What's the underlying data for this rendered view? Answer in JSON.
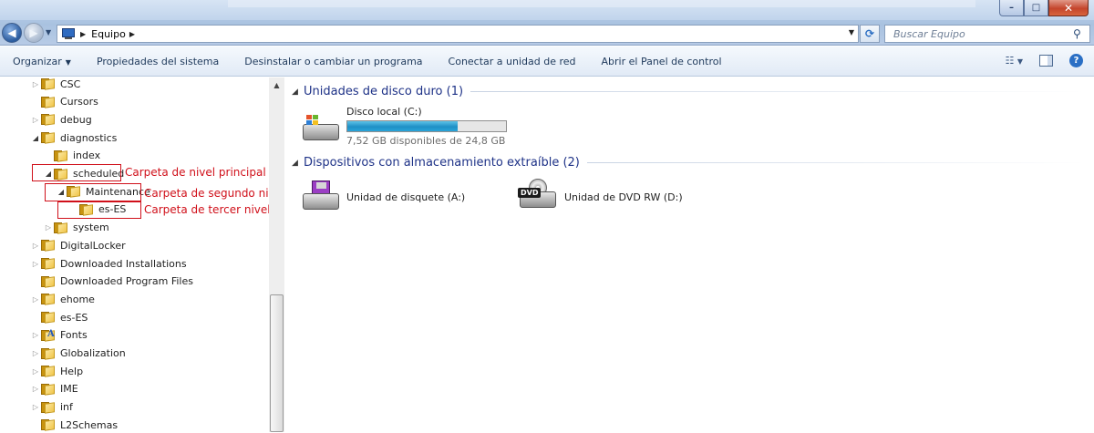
{
  "window": {
    "minimize": "–",
    "maximize": "□",
    "close": "✕"
  },
  "address": {
    "location": "Equipo"
  },
  "search": {
    "placeholder": "Buscar Equipo"
  },
  "toolbar": {
    "items": [
      "Organizar",
      "Propiedades del sistema",
      "Desinstalar o cambiar un programa",
      "Conectar a unidad de red",
      "Abrir el Panel de control"
    ]
  },
  "tree": [
    {
      "label": "CSC",
      "level": 0,
      "state": "collapsed"
    },
    {
      "label": "Cursors",
      "level": 0,
      "state": "none"
    },
    {
      "label": "debug",
      "level": 0,
      "state": "collapsed"
    },
    {
      "label": "diagnostics",
      "level": 0,
      "state": "expanded"
    },
    {
      "label": "index",
      "level": 1,
      "state": "none"
    },
    {
      "label": "scheduled",
      "level": 1,
      "state": "expanded"
    },
    {
      "label": "Maintenance",
      "level": 2,
      "state": "expanded"
    },
    {
      "label": "es-ES",
      "level": 3,
      "state": "none"
    },
    {
      "label": "system",
      "level": 1,
      "state": "collapsed"
    },
    {
      "label": "DigitalLocker",
      "level": 0,
      "state": "collapsed"
    },
    {
      "label": "Downloaded Installations",
      "level": 0,
      "state": "collapsed"
    },
    {
      "label": "Downloaded Program Files",
      "level": 0,
      "state": "none"
    },
    {
      "label": "ehome",
      "level": 0,
      "state": "collapsed"
    },
    {
      "label": "es-ES",
      "level": 0,
      "state": "none"
    },
    {
      "label": "Fonts",
      "level": 0,
      "state": "collapsed",
      "icon": "fonts-folder-icon"
    },
    {
      "label": "Globalization",
      "level": 0,
      "state": "collapsed"
    },
    {
      "label": "Help",
      "level": 0,
      "state": "collapsed"
    },
    {
      "label": "IME",
      "level": 0,
      "state": "collapsed"
    },
    {
      "label": "inf",
      "level": 0,
      "state": "collapsed"
    },
    {
      "label": "L2Schemas",
      "level": 0,
      "state": "none"
    }
  ],
  "annotations": {
    "first": "Carpeta de nivel principal",
    "second": "Carpeta de segundo nivel",
    "third": "Carpeta de tercer nivel",
    "color": "#d0101a"
  },
  "content": {
    "hdd_group": "Unidades de disco duro (1)",
    "removable_group": "Dispositivos con almacenamiento extraíble (2)",
    "local_disk": {
      "name": "Disco local (C:)",
      "free_text": "7,52 GB disponibles de 24,8 GB",
      "used_fraction": 0.697
    },
    "floppy": {
      "name": "Unidad de disquete (A:)"
    },
    "dvd": {
      "name": "Unidad de DVD RW (D:)",
      "badge": "DVD"
    }
  },
  "colors": {
    "group_title": "#1e3287",
    "toolbar_text": "#1e395b",
    "capacity_fill": "#1f8fc5"
  }
}
